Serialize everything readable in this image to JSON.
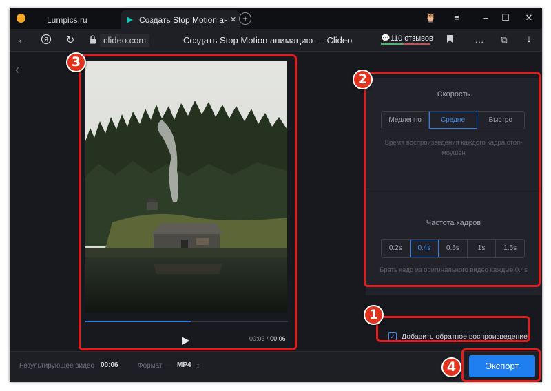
{
  "browser": {
    "tabs": [
      {
        "title": "Lumpics.ru",
        "active": false
      },
      {
        "title": "Создать Stop Motion анимацию",
        "active": true
      }
    ],
    "url": "clideo.com",
    "page_title": "Создать Stop Motion анимацию — Clideo",
    "reviews": {
      "label": "110 отзывов",
      "positive_fraction": 0.45
    }
  },
  "player": {
    "current_time": "00:03",
    "separator": "/",
    "duration": "00:06",
    "progress": 0.52
  },
  "settings": {
    "speed": {
      "title": "Скорость",
      "options": [
        "Медленно",
        "Средне",
        "Быстро"
      ],
      "selected": "Средне",
      "hint": "Время воспроизведения каждого кадра стоп-моушен"
    },
    "frame_rate": {
      "title": "Частота кадров",
      "options": [
        "0.2s",
        "0.4s",
        "0.6s",
        "1s",
        "1.5s"
      ],
      "selected": "0.4s",
      "hint": "Брать кадр из оригинального видео каждые 0.4s"
    },
    "reverse": {
      "label": "Добавить обратное воспроизведение",
      "checked": true
    }
  },
  "footer": {
    "result_label": "Результирующее видео —",
    "result_value": "00:06",
    "format_label": "Формат —",
    "format_value": "MP4",
    "export_label": "Экспорт"
  },
  "annotations": [
    "1",
    "2",
    "3",
    "4"
  ],
  "colors": {
    "accent": "#1f7ff0",
    "annotation": "#e31b1b",
    "background": "#18191e"
  }
}
